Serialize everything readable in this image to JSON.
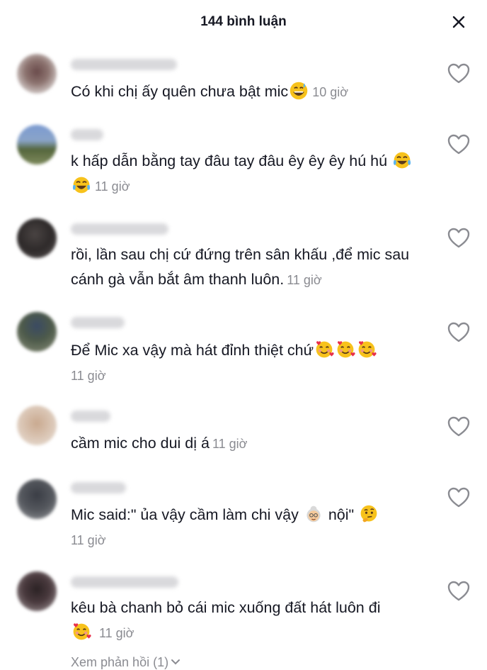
{
  "header": {
    "title": "144 bình luận",
    "close_icon": "close-icon"
  },
  "comments": [
    {
      "text": "Có khi chị ấy quên chưa bật mic",
      "emoji": [
        "grinning-sweat-emoji"
      ],
      "time": "10 giờ"
    },
    {
      "text": "k hấp dẫn bằng tay đâu tay đâu êy êy êy hú hú",
      "emoji": [
        "tears-of-joy-emoji",
        "tears-of-joy-emoji"
      ],
      "time": "11 giờ"
    },
    {
      "text": "rồi, lần sau chị cứ đứng trên sân khấu ,để mic sau cánh gà vẫn bắt âm thanh luôn.",
      "emoji": [],
      "time": "11 giờ"
    },
    {
      "text": "Để Mic xa vậy mà hát đỉnh thiệt chứ",
      "emoji": [
        "smiling-face-with-hearts-emoji",
        "smiling-face-with-hearts-emoji",
        "smiling-face-with-hearts-emoji"
      ],
      "time": "11 giờ"
    },
    {
      "text": "cầm mic cho dui dị á",
      "emoji": [],
      "time": "11 giờ"
    },
    {
      "text_before": "Mic said:\" ủa vậy cầm làm chi vậy",
      "text_after": "nội\"",
      "emoji": [
        "old-woman-emoji",
        "thinking-face-emoji"
      ],
      "time": "11 giờ"
    },
    {
      "text": "kêu bà chanh bỏ cái mic xuống đất hát luôn đi",
      "emoji": [
        "smiling-face-with-hearts-emoji"
      ],
      "time": "11 giờ"
    }
  ],
  "replies": {
    "label": "Xem phản hồi (1)"
  },
  "like_icon": "heart-outline-icon"
}
